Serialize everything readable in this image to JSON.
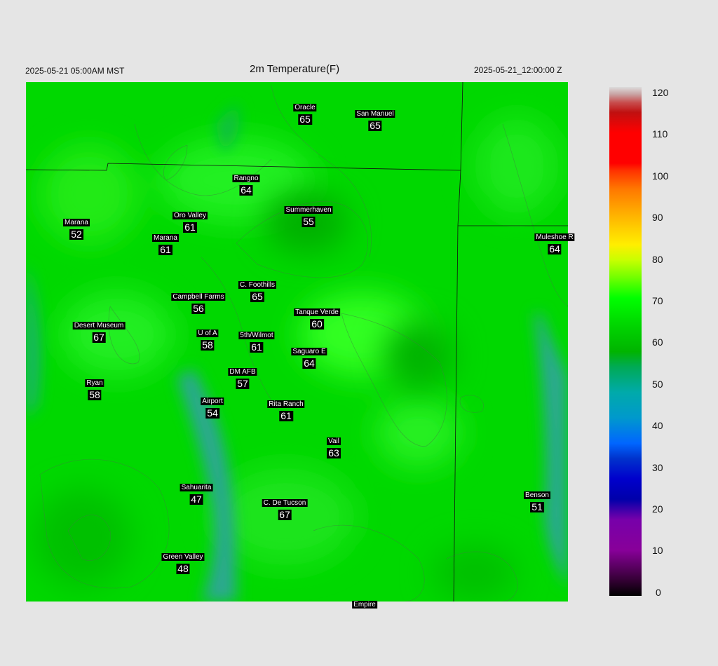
{
  "header": {
    "valid_time_local": "2025-05-21 05:00AM MST",
    "title": "2m Temperature(F)",
    "valid_time_utc": "2025-05-21_12:00:00 Z"
  },
  "colorbar": {
    "ticks": [
      "120",
      "110",
      "100",
      "90",
      "80",
      "70",
      "60",
      "50",
      "40",
      "30",
      "20",
      "10",
      "0"
    ],
    "colors": [
      "#dcdcdc",
      "#ff0000",
      "#ffa500",
      "#ffee00",
      "#00ff00",
      "#00b400",
      "#00aaaa",
      "#0066ff",
      "#0000cc",
      "#880099",
      "#000000"
    ]
  },
  "locations": [
    {
      "id": "oracle",
      "name": "Oracle",
      "value": "65"
    },
    {
      "id": "san-manuel",
      "name": "San Manuel",
      "value": "65"
    },
    {
      "id": "rangno",
      "name": "Rangno",
      "value": "64"
    },
    {
      "id": "marana-west",
      "name": "Marana",
      "value": "52"
    },
    {
      "id": "oro-valley",
      "name": "Oro Valley",
      "value": "61"
    },
    {
      "id": "summerhaven",
      "name": "Summerhaven",
      "value": "55"
    },
    {
      "id": "marana",
      "name": "Marana",
      "value": "61"
    },
    {
      "id": "muleshoe-r",
      "name": "Muleshoe R",
      "value": "64"
    },
    {
      "id": "c-foothills",
      "name": "C. Foothills",
      "value": "65"
    },
    {
      "id": "campbell-farms",
      "name": "Campbell Farms",
      "value": "56"
    },
    {
      "id": "tanque-verde",
      "name": "Tanque Verde",
      "value": "60"
    },
    {
      "id": "desert-museum",
      "name": "Desert Museum",
      "value": "67"
    },
    {
      "id": "u-of-a",
      "name": "U of A",
      "value": "58"
    },
    {
      "id": "5th-wilmot",
      "name": "5th/Wilmot",
      "value": "61"
    },
    {
      "id": "saguaro-e",
      "name": "Saguaro E",
      "value": "64"
    },
    {
      "id": "dm-afb",
      "name": "DM AFB",
      "value": "57"
    },
    {
      "id": "ryan",
      "name": "Ryan",
      "value": "58"
    },
    {
      "id": "airport",
      "name": "Airport",
      "value": "54"
    },
    {
      "id": "rita-ranch",
      "name": "Rita Ranch",
      "value": "61"
    },
    {
      "id": "vail",
      "name": "Vail",
      "value": "63"
    },
    {
      "id": "sahuarita",
      "name": "Sahuarita",
      "value": "47"
    },
    {
      "id": "c-de-tucson",
      "name": "C. De Tucson",
      "value": "67"
    },
    {
      "id": "benson",
      "name": "Benson",
      "value": "51"
    },
    {
      "id": "green-valley",
      "name": "Green Valley",
      "value": "48"
    },
    {
      "id": "empire",
      "name": "Empire",
      "value": ""
    }
  ]
}
